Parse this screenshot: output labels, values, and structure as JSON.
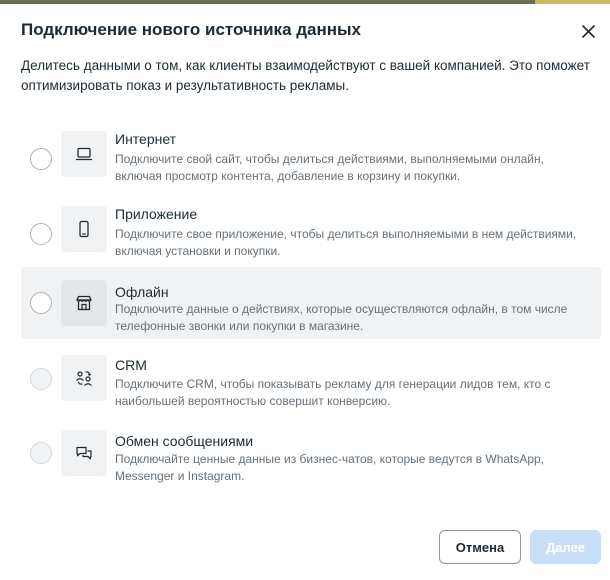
{
  "dialog": {
    "title": "Подключение нового источника данных",
    "description": "Делитесь данными о том, как клиенты взаимодействуют с вашей компанией. Это поможет оптимизировать показ и результативность рекламы."
  },
  "options": [
    {
      "title": "Интернет",
      "description": "Подключите свой сайт, чтобы делиться действиями, выполняемыми онлайн, включая просмотр контента, добавление в корзину и покупки.",
      "icon": "laptop-icon"
    },
    {
      "title": "Приложение",
      "description": "Подключите свое приложение, чтобы делиться выполняемыми в нем действиями, включая установки и покупки.",
      "icon": "mobile-phone-icon"
    },
    {
      "title": "Офлайн",
      "description": "Подключите данные о действиях, которые осуществляются офлайн, в том числе телефонные звонки или покупки в магазине.",
      "icon": "storefront-icon"
    },
    {
      "title": "CRM",
      "description": "Подключите CRM, чтобы показывать рекламу для генерации лидов тем, кто с наибольшей вероятностью совершит конверсию.",
      "icon": "people-sync-icon"
    },
    {
      "title": "Обмен сообщениями",
      "description": "Подключайте ценные данные из бизнес-чатов, которые ведутся в WhatsApp, Messenger и Instagram.",
      "icon": "chat-bubbles-icon"
    }
  ],
  "footer": {
    "cancel_label": "Отмена",
    "next_label": "Далее"
  }
}
